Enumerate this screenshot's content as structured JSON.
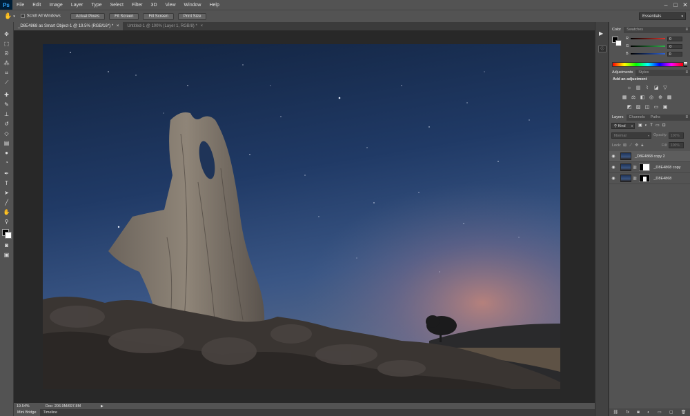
{
  "app": {
    "logo": "Ps"
  },
  "menu": [
    "File",
    "Edit",
    "Image",
    "Layer",
    "Type",
    "Select",
    "Filter",
    "3D",
    "View",
    "Window",
    "Help"
  ],
  "window_controls": {
    "minimize": "–",
    "maximize": "□",
    "close": "✕"
  },
  "options_bar": {
    "scroll_all_windows": "Scroll All Windows",
    "buttons": [
      "Actual Pixels",
      "Fit Screen",
      "Fill Screen",
      "Print Size"
    ],
    "workspace": "Essentials"
  },
  "tabs": [
    {
      "label": "_D8E4868 as Smart Object-1 @ 19.5% (RGB/16*) *",
      "close": "×"
    },
    {
      "label": "Untitled-1 @ 100% (Layer 1, RGB/8) *",
      "close": "×"
    }
  ],
  "status": {
    "zoom": "19.54%",
    "doc": "Doc: 206.9M/697.8M",
    "arrow": "▶"
  },
  "bottom_tabs": [
    "Mini Bridge",
    "Timeline"
  ],
  "color_panel": {
    "tabs": [
      "Color",
      "Swatches"
    ],
    "channels": [
      {
        "label": "R",
        "value": "0",
        "color": "#d9342b"
      },
      {
        "label": "G",
        "value": "0",
        "color": "#2fb34a"
      },
      {
        "label": "B",
        "value": "0",
        "color": "#2e63d6"
      }
    ]
  },
  "adjustments_panel": {
    "tabs": [
      "Adjustments",
      "Styles"
    ],
    "title": "Add an adjustment"
  },
  "layers_panel": {
    "tabs": [
      "Layers",
      "Channels",
      "Paths"
    ],
    "filter": "Kind",
    "blend_mode": "Normal",
    "opacity_label": "Opacity:",
    "opacity_value": "100%",
    "lock_label": "Lock:",
    "fill_label": "Fill:",
    "fill_value": "100%",
    "layers": [
      {
        "name": "_D8E4868 copy 2",
        "has_mask": false
      },
      {
        "name": "_D8E4868 copy",
        "has_mask": true
      },
      {
        "name": "_D8E4868",
        "has_mask": true
      }
    ]
  }
}
